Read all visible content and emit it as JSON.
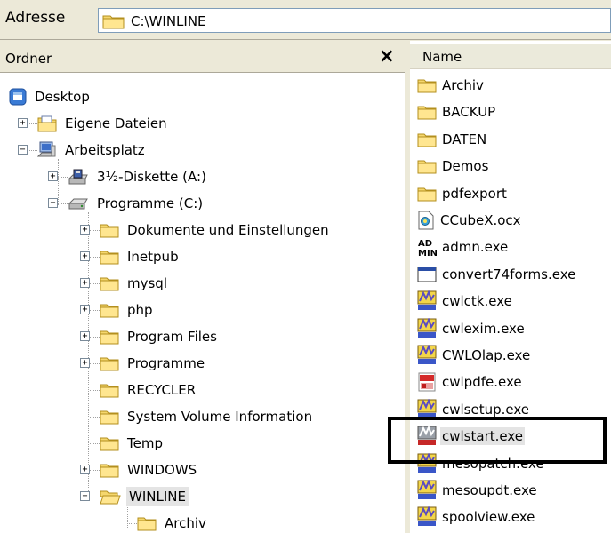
{
  "address": {
    "label": "Adresse",
    "path": "C:\\WINLINE"
  },
  "folders_pane": {
    "title": "Ordner",
    "close_glyph": "×"
  },
  "tree": [
    {
      "label": "Desktop",
      "icon": "desktop-icon"
    },
    {
      "label": "Eigene Dateien",
      "icon": "my-documents-icon",
      "expander": "+"
    },
    {
      "label": "Arbeitsplatz",
      "icon": "my-computer-icon",
      "expander": "−"
    },
    {
      "label": "3½-Diskette (A:)",
      "icon": "floppy-drive-icon",
      "expander": "+"
    },
    {
      "label": "Programme (C:)",
      "icon": "hard-drive-icon",
      "expander": "−"
    },
    {
      "label": "Dokumente und Einstellungen",
      "icon": "folder-icon",
      "expander": "+"
    },
    {
      "label": "Inetpub",
      "icon": "folder-icon",
      "expander": "+"
    },
    {
      "label": "mysql",
      "icon": "folder-icon",
      "expander": "+"
    },
    {
      "label": "php",
      "icon": "folder-icon",
      "expander": "+"
    },
    {
      "label": "Program Files",
      "icon": "folder-icon",
      "expander": "+"
    },
    {
      "label": "Programme",
      "icon": "folder-icon",
      "expander": "+"
    },
    {
      "label": "RECYCLER",
      "icon": "folder-icon"
    },
    {
      "label": "System Volume Information",
      "icon": "folder-icon"
    },
    {
      "label": "Temp",
      "icon": "folder-icon"
    },
    {
      "label": "WINDOWS",
      "icon": "folder-icon",
      "expander": "+"
    },
    {
      "label": "WINLINE",
      "icon": "folder-open-icon",
      "expander": "−",
      "selected": true
    },
    {
      "label": "Archiv",
      "icon": "folder-icon"
    }
  ],
  "files_pane": {
    "column_name": "Name"
  },
  "files": [
    {
      "name": "Archiv",
      "icon": "folder-icon"
    },
    {
      "name": "BACKUP",
      "icon": "folder-icon"
    },
    {
      "name": "DATEN",
      "icon": "folder-icon"
    },
    {
      "name": "Demos",
      "icon": "folder-icon"
    },
    {
      "name": "pdfexport",
      "icon": "folder-icon"
    },
    {
      "name": "CCubeX.ocx",
      "icon": "ocx-file-icon"
    },
    {
      "name": "admn.exe",
      "icon": "admin-exe-icon"
    },
    {
      "name": "convert74forms.exe",
      "icon": "window-exe-icon"
    },
    {
      "name": "cwlctk.exe",
      "icon": "mesonic-exe-icon"
    },
    {
      "name": "cwlexim.exe",
      "icon": "mesonic-exe-icon"
    },
    {
      "name": "CWLOlap.exe",
      "icon": "mesonic-exe-icon"
    },
    {
      "name": "cwlpdfe.exe",
      "icon": "pdf-exe-icon"
    },
    {
      "name": "cwlsetup.exe",
      "icon": "mesonic-exe-icon"
    },
    {
      "name": "cwlstart.exe",
      "icon": "mesonic-start-exe-icon",
      "selected": true
    },
    {
      "name": "mesopatch.exe",
      "icon": "mesonic-exe-icon"
    },
    {
      "name": "mesoupdt.exe",
      "icon": "mesonic-exe-icon"
    },
    {
      "name": "spoolview.exe",
      "icon": "mesonic-exe-icon"
    }
  ],
  "colors": {
    "folder": "#f5d76e",
    "selection": "#e4e4e4",
    "frame": "#ece9d8"
  }
}
